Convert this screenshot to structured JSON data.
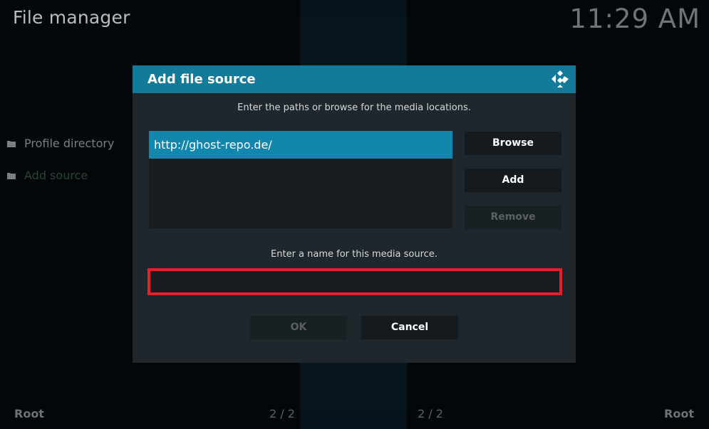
{
  "header": {
    "app_title": "File manager",
    "clock": "11:29 AM"
  },
  "sidebar": {
    "items": [
      {
        "label": "Profile directory",
        "icon": "folder-icon"
      },
      {
        "label": "Add source",
        "icon": "folder-icon"
      }
    ]
  },
  "footer": {
    "left_label": "Root",
    "right_label": "Root",
    "left_count": "2 / 2",
    "right_count": "2 / 2"
  },
  "dialog": {
    "title": "Add file source",
    "logo_icon": "kodi-logo-icon",
    "paths_instruction": "Enter the paths or browse for the media locations.",
    "paths": [
      "http://ghost-repo.de/"
    ],
    "buttons": {
      "browse": "Browse",
      "add": "Add",
      "remove": "Remove",
      "ok": "OK",
      "cancel": "Cancel"
    },
    "name_instruction": "Enter a name for this media source.",
    "name_value": ""
  },
  "colors": {
    "accent": "#137a9a",
    "selected": "#1386ad",
    "highlight_border": "#e1222a"
  }
}
